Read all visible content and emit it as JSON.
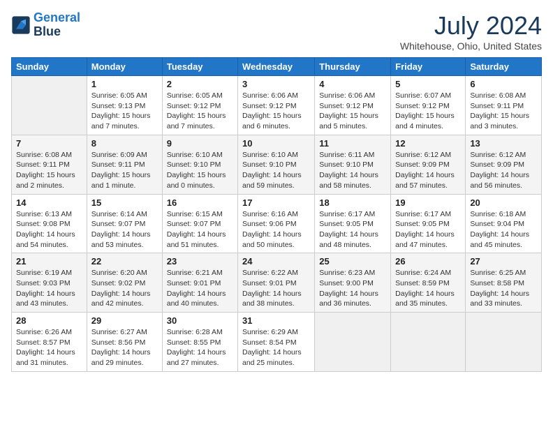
{
  "header": {
    "logo_line1": "General",
    "logo_line2": "Blue",
    "month_year": "July 2024",
    "location": "Whitehouse, Ohio, United States"
  },
  "weekdays": [
    "Sunday",
    "Monday",
    "Tuesday",
    "Wednesday",
    "Thursday",
    "Friday",
    "Saturday"
  ],
  "weeks": [
    [
      {
        "day": "",
        "empty": true
      },
      {
        "day": "1",
        "sunrise": "Sunrise: 6:05 AM",
        "sunset": "Sunset: 9:13 PM",
        "daylight": "Daylight: 15 hours and 7 minutes."
      },
      {
        "day": "2",
        "sunrise": "Sunrise: 6:05 AM",
        "sunset": "Sunset: 9:12 PM",
        "daylight": "Daylight: 15 hours and 7 minutes."
      },
      {
        "day": "3",
        "sunrise": "Sunrise: 6:06 AM",
        "sunset": "Sunset: 9:12 PM",
        "daylight": "Daylight: 15 hours and 6 minutes."
      },
      {
        "day": "4",
        "sunrise": "Sunrise: 6:06 AM",
        "sunset": "Sunset: 9:12 PM",
        "daylight": "Daylight: 15 hours and 5 minutes."
      },
      {
        "day": "5",
        "sunrise": "Sunrise: 6:07 AM",
        "sunset": "Sunset: 9:12 PM",
        "daylight": "Daylight: 15 hours and 4 minutes."
      },
      {
        "day": "6",
        "sunrise": "Sunrise: 6:08 AM",
        "sunset": "Sunset: 9:11 PM",
        "daylight": "Daylight: 15 hours and 3 minutes."
      }
    ],
    [
      {
        "day": "7",
        "sunrise": "Sunrise: 6:08 AM",
        "sunset": "Sunset: 9:11 PM",
        "daylight": "Daylight: 15 hours and 2 minutes."
      },
      {
        "day": "8",
        "sunrise": "Sunrise: 6:09 AM",
        "sunset": "Sunset: 9:11 PM",
        "daylight": "Daylight: 15 hours and 1 minute."
      },
      {
        "day": "9",
        "sunrise": "Sunrise: 6:10 AM",
        "sunset": "Sunset: 9:10 PM",
        "daylight": "Daylight: 15 hours and 0 minutes."
      },
      {
        "day": "10",
        "sunrise": "Sunrise: 6:10 AM",
        "sunset": "Sunset: 9:10 PM",
        "daylight": "Daylight: 14 hours and 59 minutes."
      },
      {
        "day": "11",
        "sunrise": "Sunrise: 6:11 AM",
        "sunset": "Sunset: 9:10 PM",
        "daylight": "Daylight: 14 hours and 58 minutes."
      },
      {
        "day": "12",
        "sunrise": "Sunrise: 6:12 AM",
        "sunset": "Sunset: 9:09 PM",
        "daylight": "Daylight: 14 hours and 57 minutes."
      },
      {
        "day": "13",
        "sunrise": "Sunrise: 6:12 AM",
        "sunset": "Sunset: 9:09 PM",
        "daylight": "Daylight: 14 hours and 56 minutes."
      }
    ],
    [
      {
        "day": "14",
        "sunrise": "Sunrise: 6:13 AM",
        "sunset": "Sunset: 9:08 PM",
        "daylight": "Daylight: 14 hours and 54 minutes."
      },
      {
        "day": "15",
        "sunrise": "Sunrise: 6:14 AM",
        "sunset": "Sunset: 9:07 PM",
        "daylight": "Daylight: 14 hours and 53 minutes."
      },
      {
        "day": "16",
        "sunrise": "Sunrise: 6:15 AM",
        "sunset": "Sunset: 9:07 PM",
        "daylight": "Daylight: 14 hours and 51 minutes."
      },
      {
        "day": "17",
        "sunrise": "Sunrise: 6:16 AM",
        "sunset": "Sunset: 9:06 PM",
        "daylight": "Daylight: 14 hours and 50 minutes."
      },
      {
        "day": "18",
        "sunrise": "Sunrise: 6:17 AM",
        "sunset": "Sunset: 9:05 PM",
        "daylight": "Daylight: 14 hours and 48 minutes."
      },
      {
        "day": "19",
        "sunrise": "Sunrise: 6:17 AM",
        "sunset": "Sunset: 9:05 PM",
        "daylight": "Daylight: 14 hours and 47 minutes."
      },
      {
        "day": "20",
        "sunrise": "Sunrise: 6:18 AM",
        "sunset": "Sunset: 9:04 PM",
        "daylight": "Daylight: 14 hours and 45 minutes."
      }
    ],
    [
      {
        "day": "21",
        "sunrise": "Sunrise: 6:19 AM",
        "sunset": "Sunset: 9:03 PM",
        "daylight": "Daylight: 14 hours and 43 minutes."
      },
      {
        "day": "22",
        "sunrise": "Sunrise: 6:20 AM",
        "sunset": "Sunset: 9:02 PM",
        "daylight": "Daylight: 14 hours and 42 minutes."
      },
      {
        "day": "23",
        "sunrise": "Sunrise: 6:21 AM",
        "sunset": "Sunset: 9:01 PM",
        "daylight": "Daylight: 14 hours and 40 minutes."
      },
      {
        "day": "24",
        "sunrise": "Sunrise: 6:22 AM",
        "sunset": "Sunset: 9:01 PM",
        "daylight": "Daylight: 14 hours and 38 minutes."
      },
      {
        "day": "25",
        "sunrise": "Sunrise: 6:23 AM",
        "sunset": "Sunset: 9:00 PM",
        "daylight": "Daylight: 14 hours and 36 minutes."
      },
      {
        "day": "26",
        "sunrise": "Sunrise: 6:24 AM",
        "sunset": "Sunset: 8:59 PM",
        "daylight": "Daylight: 14 hours and 35 minutes."
      },
      {
        "day": "27",
        "sunrise": "Sunrise: 6:25 AM",
        "sunset": "Sunset: 8:58 PM",
        "daylight": "Daylight: 14 hours and 33 minutes."
      }
    ],
    [
      {
        "day": "28",
        "sunrise": "Sunrise: 6:26 AM",
        "sunset": "Sunset: 8:57 PM",
        "daylight": "Daylight: 14 hours and 31 minutes."
      },
      {
        "day": "29",
        "sunrise": "Sunrise: 6:27 AM",
        "sunset": "Sunset: 8:56 PM",
        "daylight": "Daylight: 14 hours and 29 minutes."
      },
      {
        "day": "30",
        "sunrise": "Sunrise: 6:28 AM",
        "sunset": "Sunset: 8:55 PM",
        "daylight": "Daylight: 14 hours and 27 minutes."
      },
      {
        "day": "31",
        "sunrise": "Sunrise: 6:29 AM",
        "sunset": "Sunset: 8:54 PM",
        "daylight": "Daylight: 14 hours and 25 minutes."
      },
      {
        "day": "",
        "empty": true
      },
      {
        "day": "",
        "empty": true
      },
      {
        "day": "",
        "empty": true
      }
    ]
  ]
}
